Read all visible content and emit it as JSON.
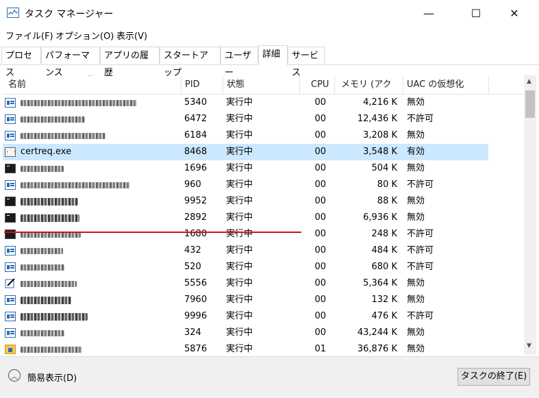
{
  "window": {
    "title": "タスク マネージャー",
    "minimize_glyph": "—",
    "maximize_glyph": "☐",
    "close_glyph": "✕"
  },
  "menu": [
    "ファイル(F)",
    "オプション(O)",
    "表示(V)"
  ],
  "tabs": [
    "プロセス",
    "パフォーマンス",
    "アプリの履歴",
    "スタートアップ",
    "ユーザー",
    "詳細",
    "サービス"
  ],
  "active_tab": "詳細",
  "columns": {
    "name": "名前",
    "pid": "PID",
    "status": "状態",
    "cpu": "CPU",
    "memory": "メモリ (アクテ...",
    "uac": "UAC の仮想化"
  },
  "rows": [
    {
      "name": "",
      "icon": "app-window-icon",
      "pid": "5340",
      "status": "実行中",
      "cpu": "00",
      "memory": "4,216 K",
      "uac": "無効"
    },
    {
      "name": "",
      "icon": "app-window-icon",
      "pid": "6472",
      "status": "実行中",
      "cpu": "00",
      "memory": "12,436 K",
      "uac": "不許可"
    },
    {
      "name": "",
      "icon": "app-window-icon",
      "pid": "6184",
      "status": "実行中",
      "cpu": "00",
      "memory": "3,208 K",
      "uac": "無効"
    },
    {
      "name": "certreq.exe",
      "icon": "certificate-icon",
      "pid": "8468",
      "status": "実行中",
      "cpu": "00",
      "memory": "3,548 K",
      "uac": "有効",
      "selected": true
    },
    {
      "name": "",
      "icon": "console-icon",
      "pid": "1696",
      "status": "実行中",
      "cpu": "00",
      "memory": "504 K",
      "uac": "無効"
    },
    {
      "name": "",
      "icon": "app-window-icon",
      "pid": "960",
      "status": "実行中",
      "cpu": "00",
      "memory": "80 K",
      "uac": "不許可"
    },
    {
      "name": "",
      "icon": "console-icon",
      "pid": "9952",
      "status": "実行中",
      "cpu": "00",
      "memory": "88 K",
      "uac": "無効"
    },
    {
      "name": "",
      "icon": "console-icon",
      "pid": "2892",
      "status": "実行中",
      "cpu": "00",
      "memory": "6,936 K",
      "uac": "無効"
    },
    {
      "name": "",
      "icon": "console-icon",
      "pid": "1680",
      "status": "実行中",
      "cpu": "00",
      "memory": "248 K",
      "uac": "不許可"
    },
    {
      "name": "",
      "icon": "app-window-icon",
      "pid": "432",
      "status": "実行中",
      "cpu": "00",
      "memory": "484 K",
      "uac": "不許可"
    },
    {
      "name": "",
      "icon": "app-window-icon",
      "pid": "520",
      "status": "実行中",
      "cpu": "00",
      "memory": "680 K",
      "uac": "不許可"
    },
    {
      "name": "",
      "icon": "pen-icon",
      "pid": "5556",
      "status": "実行中",
      "cpu": "00",
      "memory": "5,364 K",
      "uac": "無効"
    },
    {
      "name": "",
      "icon": "app-window-icon",
      "pid": "7960",
      "status": "実行中",
      "cpu": "00",
      "memory": "132 K",
      "uac": "無効"
    },
    {
      "name": "",
      "icon": "app-window-icon",
      "pid": "9996",
      "status": "実行中",
      "cpu": "00",
      "memory": "476 K",
      "uac": "不許可"
    },
    {
      "name": "",
      "icon": "app-window-icon",
      "pid": "324",
      "status": "実行中",
      "cpu": "00",
      "memory": "43,244 K",
      "uac": "無効"
    },
    {
      "name": "",
      "icon": "folder-icon",
      "pid": "5876",
      "status": "実行中",
      "cpu": "01",
      "memory": "36,876 K",
      "uac": "無効"
    }
  ],
  "footer": {
    "collapse_label": "簡易表示(D)",
    "end_task_label": "タスクの終了(E)"
  }
}
